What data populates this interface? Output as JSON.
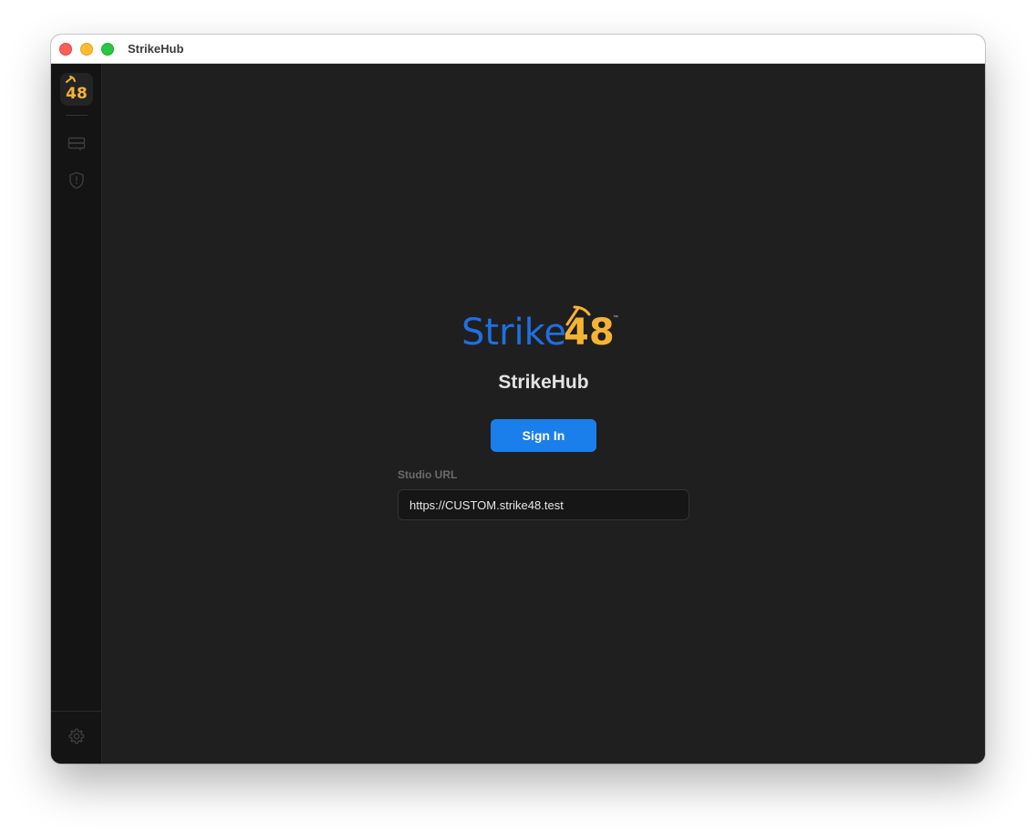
{
  "window": {
    "title": "StrikeHub"
  },
  "sidebar": {
    "logo_icon": "strike48-app-icon",
    "logo_text": "48",
    "items": [
      {
        "icon": "server-rack-icon"
      },
      {
        "icon": "shield-icon"
      }
    ],
    "settings_icon": "gear-icon"
  },
  "main": {
    "brand": {
      "word": "Strike",
      "number": "48",
      "trademark": "™"
    },
    "app_name": "StrikeHub",
    "sign_in_label": "Sign In",
    "studio_url_label": "Studio URL",
    "studio_url_value": "https://CUSTOM.strike48.test"
  },
  "colors": {
    "brand_blue": "#1f6fe0",
    "brand_orange": "#f5b335",
    "button_blue": "#1a7fea",
    "background": "#1f1f1f",
    "sidebar": "#141414"
  }
}
